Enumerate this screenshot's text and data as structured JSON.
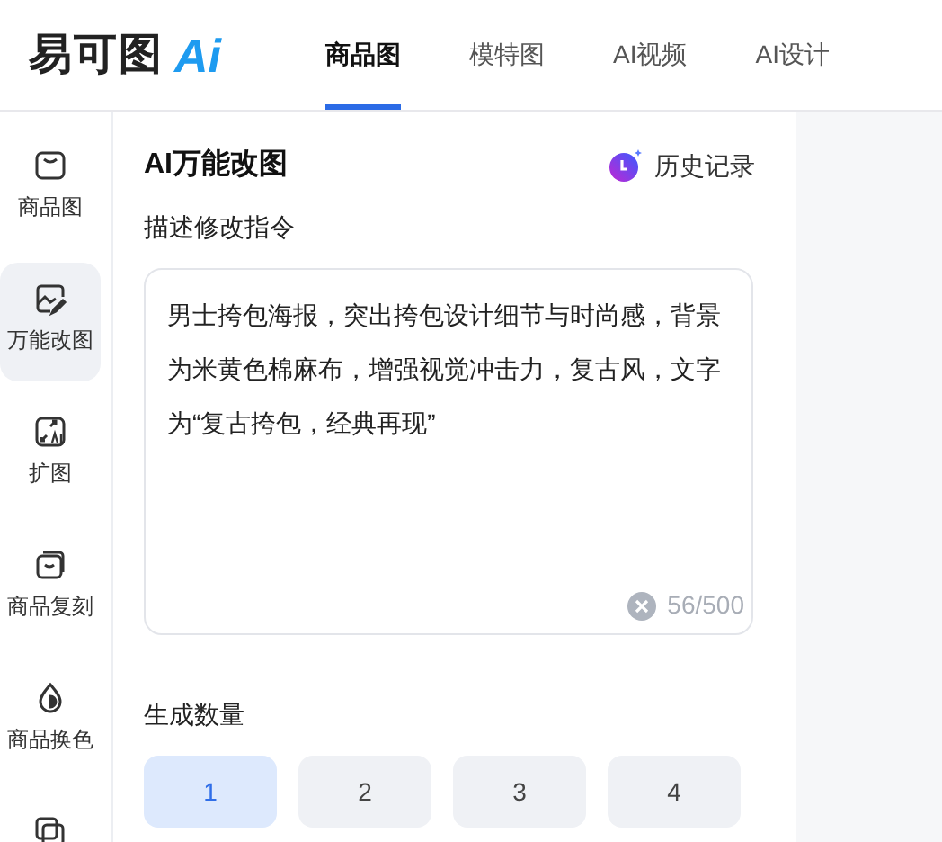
{
  "logo": {
    "text": "易可图",
    "badge": "Ai"
  },
  "nav": [
    {
      "label": "商品图",
      "selected": true
    },
    {
      "label": "模特图",
      "selected": false
    },
    {
      "label": "AI视频",
      "selected": false
    },
    {
      "label": "AI设计",
      "selected": false
    }
  ],
  "sidebar": {
    "items": [
      {
        "kind": "bag",
        "label": "商品图",
        "selected": false
      },
      {
        "kind": "edit",
        "label": "万能改图",
        "selected": true
      },
      {
        "kind": "expand",
        "label": "扩图",
        "selected": false
      },
      {
        "kind": "copy",
        "label": "商品复刻",
        "selected": false
      },
      {
        "kind": "drop",
        "label": "商品换色",
        "selected": false
      },
      {
        "kind": "images",
        "selected": false
      }
    ]
  },
  "panel": {
    "title": "AI万能改图",
    "history": "历史记录",
    "prompt_label": "描述修改指令",
    "prompt": "男士挎包海报，突出挎包设计细节与时尚感，背景为米黄色棉麻布，增强视觉冲击力，复古风，文字为“复古挎包，经典再现”",
    "counter": "56/500",
    "count_label": "生成数量",
    "counts": [
      {
        "label": "1",
        "selected": true
      },
      {
        "label": "2",
        "selected": false
      },
      {
        "label": "3",
        "selected": false
      },
      {
        "label": "4",
        "selected": false
      }
    ]
  }
}
